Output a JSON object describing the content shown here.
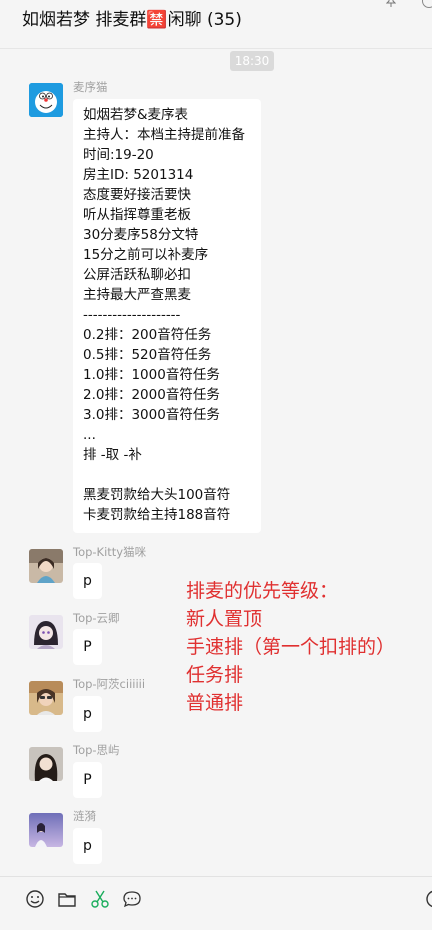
{
  "window": {
    "title": "如烟若梦 排麦群🈲闲聊 (35)"
  },
  "chat": {
    "timestamp": "18:30",
    "main_message": {
      "sender": "麦序猫",
      "lines": [
        "如烟若梦&麦序表",
        "主持人：本档主持提前准备",
        "时间:19-20",
        "房主ID:  5201314",
        "态度要好接活要快",
        "听从指挥尊重老板",
        "30分麦序58分文特",
        "15分之前可以补麦序",
        "公屏活跃私聊必扣",
        "主持最大严查黑麦",
        "--------------------",
        "0.2排：200音符任务",
        "0.5排：520音符任务",
        "1.0排：1000音符任务",
        "2.0排：2000音符任务",
        "3.0排：3000音符任务",
        "...",
        "排 -取 -补",
        "",
        "黑麦罚款给大头100音符",
        "卡麦罚款给主持188音符"
      ]
    },
    "replies": [
      {
        "sender": "Top-Kitty猫咪",
        "text": "p"
      },
      {
        "sender": "Top-云卿",
        "text": "P"
      },
      {
        "sender": "Top-阿茨ciiiiii",
        "text": "p"
      },
      {
        "sender": "Top-思屿",
        "text": "P"
      },
      {
        "sender": "涟漪",
        "text": "p"
      }
    ]
  },
  "annotation": {
    "lines": [
      "排麦的优先等级：",
      "新人置顶",
      "手速排（第一个扣排的）",
      "任务排",
      "普通排"
    ],
    "color": "#e03030"
  },
  "toolbar": {
    "icons": [
      "emoji-icon",
      "folder-icon",
      "scissors-icon",
      "chat-bubble-icon"
    ]
  },
  "colors": {
    "background": "#f5f5f5",
    "bubble": "#ffffff",
    "sender_name": "#a0a0a0"
  }
}
